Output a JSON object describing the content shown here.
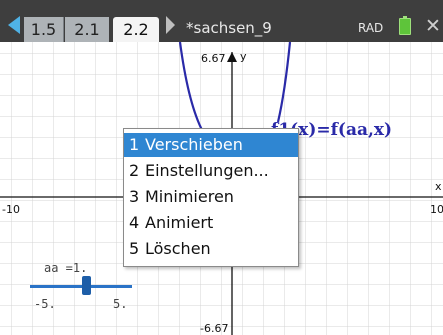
{
  "tabs": [
    {
      "label": "1.5",
      "active": false
    },
    {
      "label": "2.1",
      "active": false
    },
    {
      "label": "2.2",
      "active": true
    }
  ],
  "document_title": "*sachsen_9",
  "angle_mode": "RAD",
  "icons": {
    "nav_left": "arrow-left-icon",
    "nav_right": "arrow-right-icon",
    "battery": "battery-icon",
    "close": "close-icon"
  },
  "graph": {
    "y_max_label": "6.67",
    "y_min_label": "-6.67",
    "x_min_label": "-10",
    "x_max_label": "10",
    "y_axis_name": "y",
    "x_axis_name": "x",
    "function_label": "f1(x)=f(aa,x)",
    "grid": true,
    "curve_color": "#2a2aa8"
  },
  "slider": {
    "label": "aa =1.",
    "min_label": "-5.",
    "max_label": "5.",
    "value": 1,
    "min": -5,
    "max": 5
  },
  "context_menu": {
    "items": [
      {
        "num": "1",
        "label": "Verschieben",
        "selected": true
      },
      {
        "num": "2",
        "label": "Einstellungen...",
        "selected": false
      },
      {
        "num": "3",
        "label": "Minimieren",
        "selected": false
      },
      {
        "num": "4",
        "label": "Animiert",
        "selected": false
      },
      {
        "num": "5",
        "label": "Löschen",
        "selected": false
      }
    ]
  },
  "colors": {
    "selection": "#2f86d2",
    "tab_bar": "#3e3e3e",
    "accent": "#4fb2e6"
  }
}
